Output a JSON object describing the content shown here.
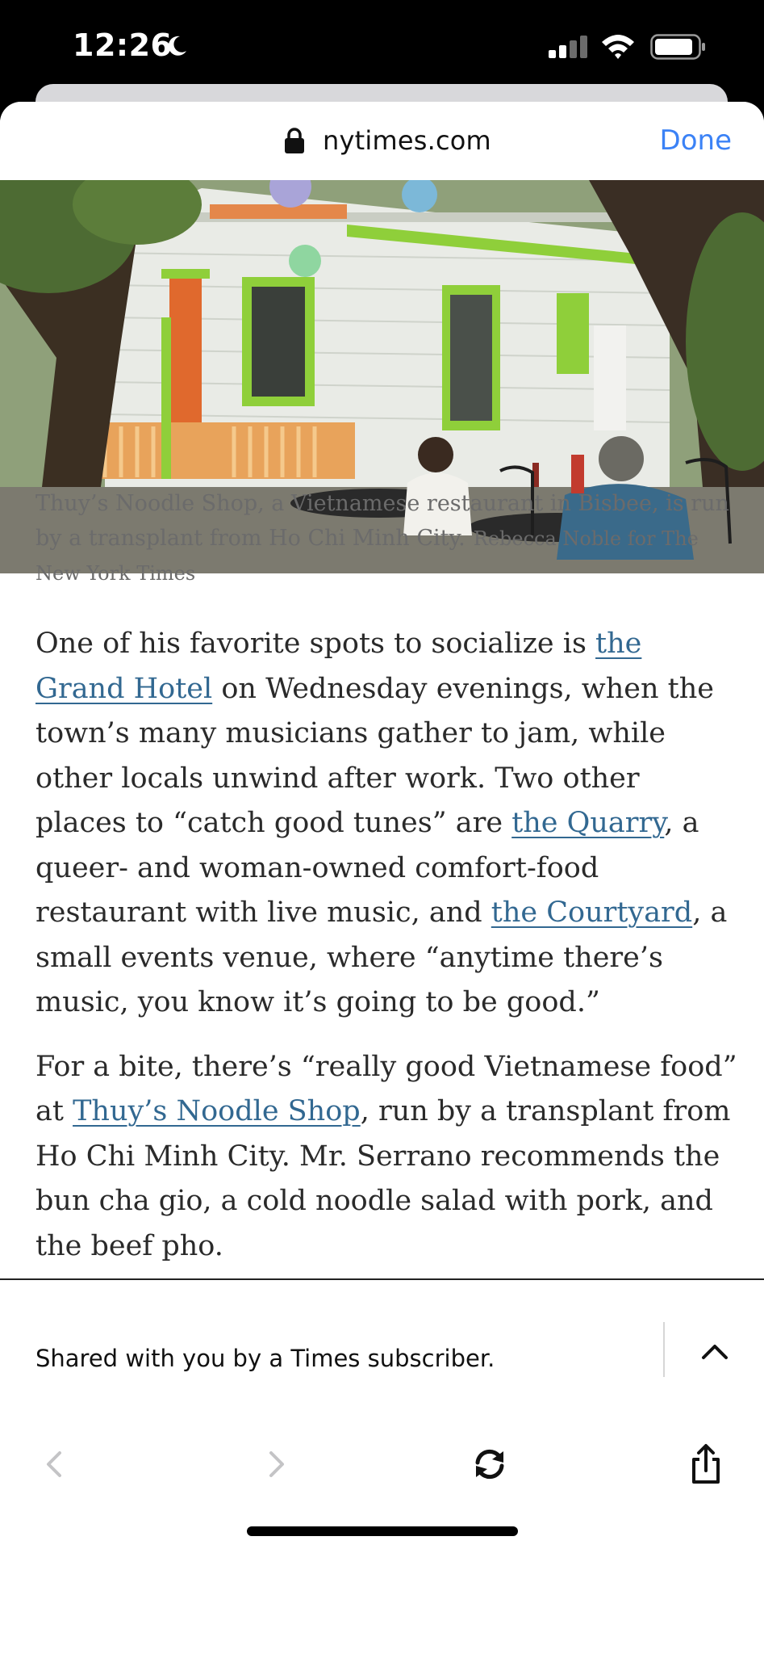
{
  "status_bar": {
    "time": "12:26",
    "icons": [
      "moon-icon",
      "signal-icon",
      "wifi-icon",
      "battery-icon"
    ]
  },
  "browser": {
    "url": "nytimes.com",
    "done_label": "Done",
    "accent_color": "#3b82f6"
  },
  "article": {
    "caption": "Thuy’s Noodle Shop, a Vietnamese restaurant in Bisbee, is run by a transplant from Ho Chi Minh City.",
    "credit": "Rebecca Noble for The New York Times",
    "paragraph1": {
      "t1": "One of his favorite spots to socialize is ",
      "link1": "the Grand Hotel",
      "t2": " on Wednesday evenings, when the town’s many musicians gather to jam, while other locals unwind after work. Two other places to “catch good tunes” are ",
      "link2": "the Quarry",
      "t3": ", a queer- and woman-owned comfort-food restaurant with live music, and ",
      "link3": "the Courtyard",
      "t4": ", a small events venue, where “anytime there’s music, you know it’s going to be good.”"
    },
    "paragraph2": {
      "t1": "For a bite, there’s “really good Vietnamese food” at ",
      "link1": "Thuy’s Noodle Shop",
      "t2": ", run by a transplant from Ho Chi Minh City. Mr. Serrano recommends the bun cha gio, a cold noodle salad with pork, and the beef pho."
    },
    "link_color": "#326891"
  },
  "banner": {
    "shared_text": "Shared with you by a Times subscriber."
  },
  "toolbar": {
    "icons": [
      "back-icon",
      "forward-icon",
      "refresh-icon",
      "share-icon"
    ]
  }
}
